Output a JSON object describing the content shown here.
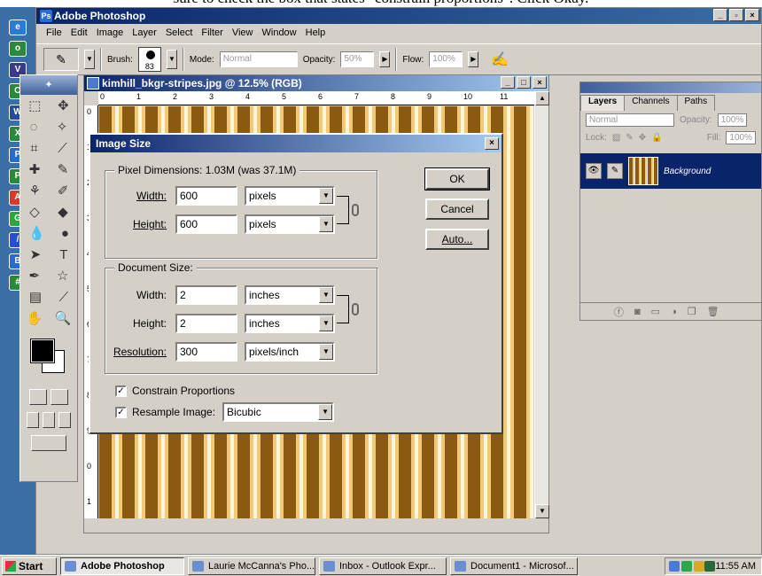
{
  "caption": "sure to check the box that states \"constrain proportions\". Click Okay.",
  "window": {
    "title": "Adobe Photoshop"
  },
  "menu": [
    "File",
    "Edit",
    "Image",
    "Layer",
    "Select",
    "Filter",
    "View",
    "Window",
    "Help"
  ],
  "options_bar": {
    "brush_label": "Brush:",
    "brush_size": "83",
    "mode_label": "Mode:",
    "mode_value": "Normal",
    "opacity_label": "Opacity:",
    "opacity_value": "50%",
    "flow_label": "Flow:",
    "flow_value": "100%"
  },
  "document": {
    "title": "kimhill_bkgr-stripes.jpg @ 12.5% (RGB)",
    "ruler_h": [
      "0",
      "1",
      "2",
      "3",
      "4",
      "5",
      "6",
      "7",
      "8",
      "9",
      "10",
      "11"
    ],
    "ruler_v": [
      "0",
      "1",
      "2",
      "3",
      "4",
      "5",
      "6",
      "7",
      "8",
      "9",
      "0",
      "1"
    ]
  },
  "dialog": {
    "title": "Image Size",
    "pixel_dimensions": {
      "legend": "Pixel Dimensions:  1.03M (was 37.1M)",
      "width_label": "Width:",
      "width_value": "600",
      "width_unit": "pixels",
      "height_label": "Height:",
      "height_value": "600",
      "height_unit": "pixels"
    },
    "document_size": {
      "legend": "Document Size:",
      "width_label": "Width:",
      "width_value": "2",
      "width_unit": "inches",
      "height_label": "Height:",
      "height_value": "2",
      "height_unit": "inches",
      "resolution_label": "Resolution:",
      "resolution_value": "300",
      "resolution_unit": "pixels/inch"
    },
    "constrain_label": "Constrain Proportions",
    "constrain_checked": true,
    "resample_label": "Resample Image:",
    "resample_checked": true,
    "resample_value": "Bicubic",
    "ok_label": "OK",
    "cancel_label": "Cancel",
    "auto_label": "Auto..."
  },
  "layers_panel": {
    "tabs": [
      "Layers",
      "Channels",
      "Paths"
    ],
    "blend_mode": "Normal",
    "opacity_label": "Opacity:",
    "opacity_value": "100%",
    "lock_label": "Lock:",
    "fill_label": "Fill:",
    "fill_value": "100%",
    "layer_name": "Background"
  },
  "taskbar": {
    "start_label": "Start",
    "tasks": [
      "Adobe Photoshop",
      "Laurie McCanna's Pho...",
      "Inbox - Outlook Expr...",
      "Document1 - Microsof..."
    ],
    "clock": "11:55 AM"
  },
  "colors": {
    "title_bar": "#0a246a",
    "stripe_dark": "#8a5a12",
    "stripe_light": "#f2c978"
  }
}
